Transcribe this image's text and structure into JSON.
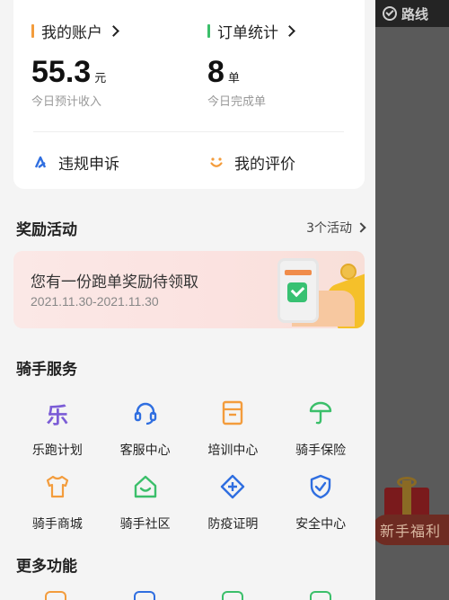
{
  "overlay": {
    "route_label": "路线",
    "welfare_label": "新手福利"
  },
  "account": {
    "title": "我的账户",
    "accent": "#f39c3c",
    "value": "55.3",
    "unit": "元",
    "caption": "今日预计收入"
  },
  "orders": {
    "title": "订单统计",
    "accent": "#3bbf6a",
    "value": "8",
    "unit": "单",
    "caption": "今日完成单"
  },
  "quick_actions": [
    {
      "label": "违规申诉",
      "icon": "appeal-icon",
      "color": "#2f6ee0"
    },
    {
      "label": "我的评价",
      "icon": "smile-icon",
      "color": "#f39c3c"
    }
  ],
  "rewards": {
    "title": "奖励活动",
    "more_label": "3个活动",
    "banner_title": "您有一份跑单奖励待领取",
    "banner_date": "2021.11.30-2021.11.30"
  },
  "rider_services": {
    "title": "骑手服务",
    "items": [
      {
        "label": "乐跑计划",
        "icon": "lepao-icon",
        "color": "#7b5cd6"
      },
      {
        "label": "客服中心",
        "icon": "headset-icon",
        "color": "#2f6ee0"
      },
      {
        "label": "培训中心",
        "icon": "training-icon",
        "color": "#f39c3c"
      },
      {
        "label": "骑手保险",
        "icon": "insurance-icon",
        "color": "#3bbf6a"
      },
      {
        "label": "骑手商城",
        "icon": "shirt-icon",
        "color": "#f39c3c"
      },
      {
        "label": "骑手社区",
        "icon": "home-icon",
        "color": "#3bbf6a"
      },
      {
        "label": "防疫证明",
        "icon": "medical-plus-icon",
        "color": "#2f6ee0"
      },
      {
        "label": "安全中心",
        "icon": "shield-check-icon",
        "color": "#2f6ee0"
      }
    ]
  },
  "more_features": {
    "title": "更多功能"
  },
  "icon_glyphs": {
    "lepao": "乐"
  }
}
